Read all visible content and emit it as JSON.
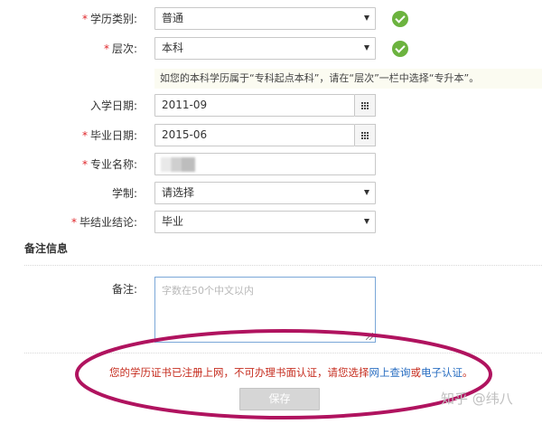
{
  "form": {
    "education_type": {
      "label": "学历类别:",
      "value": "普通",
      "required": true
    },
    "level": {
      "label": "层次:",
      "value": "本科",
      "required": true
    },
    "level_hint": "如您的本科学历属于“专科起点本科”，请在“层次”一栏中选择“专升本”。",
    "enroll_date": {
      "label": "入学日期:",
      "value": "2011-09",
      "required": false
    },
    "grad_date": {
      "label": "毕业日期:",
      "value": "2015-06",
      "required": true
    },
    "major": {
      "label": "专业名称:",
      "value": "",
      "required": true
    },
    "study_length": {
      "label": "学制:",
      "value": "请选择",
      "required": false
    },
    "completion": {
      "label": "毕结业结论:",
      "value": "毕业",
      "required": true
    }
  },
  "remarks": {
    "section_title": "备注信息",
    "label": "备注:",
    "placeholder": "字数在50个中文以内"
  },
  "notice": {
    "text_before": "您的学历证书已注册上网，不可办理书面认证，请您选择",
    "link_online": "网上查询",
    "text_or": "或",
    "link_electronic": "电子认证",
    "text_end": "。"
  },
  "save_label": "保存",
  "watermark": "知乎 @纬八",
  "colors": {
    "required_star": "#e0272b",
    "valid_check": "#6cb33f",
    "notice_text": "#c62d1f",
    "link": "#2b6fc2",
    "annotation_ellipse": "#b0135f"
  }
}
